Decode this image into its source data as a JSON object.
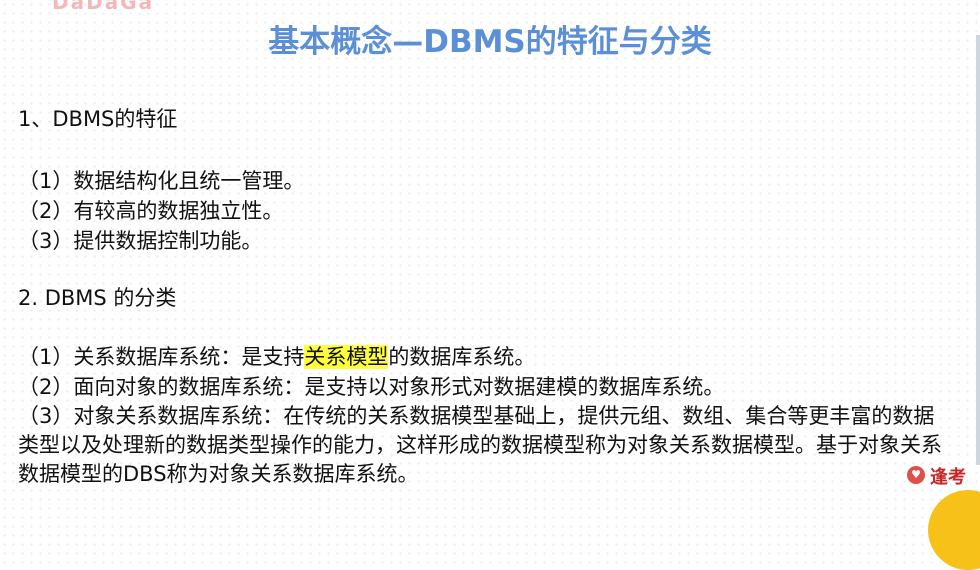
{
  "watermark_text": "DaDaGa",
  "title": "基本概念—DBMS的特征与分类",
  "section1": {
    "heading": "1、DBMS的特征",
    "items": [
      "（1）数据结构化且统一管理。",
      "（2）有较高的数据独立性。",
      "（3）提供数据控制功能。"
    ]
  },
  "section2": {
    "heading": "2. DBMS 的分类",
    "item1_pre": "（1）关系数据库系统：是支持",
    "item1_highlight": "关系模型",
    "item1_post": "的数据库系统。",
    "item2": "（2）面向对象的数据库系统：是支持以对象形式对数据建模的数据库系统。",
    "item3": "（3）对象关系数据库系统：在传统的关系数据模型基础上，提供元组、数组、集合等更丰富的数据类型以及处理新的数据类型操作的能力，这样形成的数据模型称为对象关系数据模型。基于对象关系数据模型的DBS称为对象关系数据库系统。"
  },
  "brand_text": "逢考",
  "highlight_color": "#ffff3a",
  "title_color": "#5b8fd6"
}
